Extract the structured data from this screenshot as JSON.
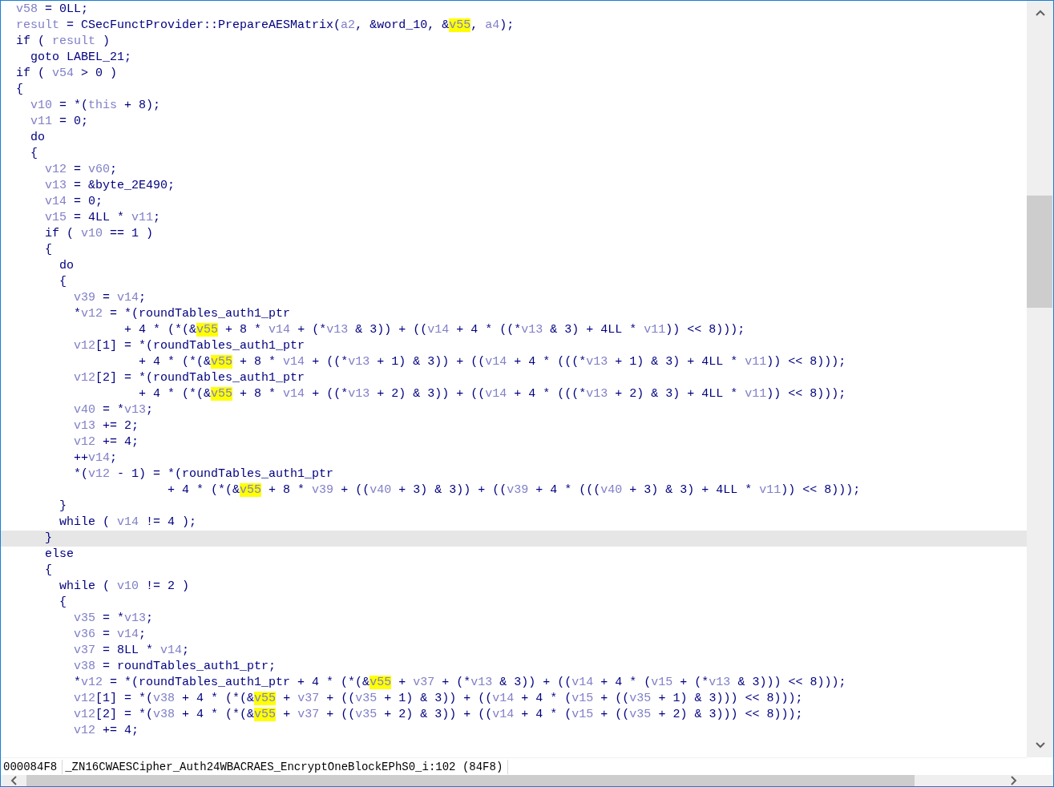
{
  "code_lines": [
    {
      "selected": false,
      "segments": [
        {
          "text": "  v58",
          "kind": "var"
        },
        {
          "text": " = 0LL;",
          "kind": "code"
        }
      ]
    },
    {
      "selected": false,
      "segments": [
        {
          "text": "  result",
          "kind": "var"
        },
        {
          "text": " = CSecFunctProvider::PrepareAESMatrix(",
          "kind": "code"
        },
        {
          "text": "a2",
          "kind": "var"
        },
        {
          "text": ", &word_10, &",
          "kind": "code"
        },
        {
          "text": "v55",
          "kind": "highlight"
        },
        {
          "text": ", ",
          "kind": "code"
        },
        {
          "text": "a4",
          "kind": "var"
        },
        {
          "text": ");",
          "kind": "code"
        }
      ]
    },
    {
      "selected": false,
      "segments": [
        {
          "text": "  if ( ",
          "kind": "code"
        },
        {
          "text": "result",
          "kind": "var"
        },
        {
          "text": " )",
          "kind": "code"
        }
      ]
    },
    {
      "selected": false,
      "segments": [
        {
          "text": "    goto LABEL_21;",
          "kind": "code"
        }
      ]
    },
    {
      "selected": false,
      "segments": [
        {
          "text": "  if ( ",
          "kind": "code"
        },
        {
          "text": "v54",
          "kind": "var"
        },
        {
          "text": " > 0 )",
          "kind": "code"
        }
      ]
    },
    {
      "selected": false,
      "segments": [
        {
          "text": "  {",
          "kind": "code"
        }
      ]
    },
    {
      "selected": false,
      "segments": [
        {
          "text": "    v10",
          "kind": "var"
        },
        {
          "text": " = *(",
          "kind": "code"
        },
        {
          "text": "this",
          "kind": "var"
        },
        {
          "text": " + 8);",
          "kind": "code"
        }
      ]
    },
    {
      "selected": false,
      "segments": [
        {
          "text": "    v11",
          "kind": "var"
        },
        {
          "text": " = 0;",
          "kind": "code"
        }
      ]
    },
    {
      "selected": false,
      "segments": [
        {
          "text": "    do",
          "kind": "code"
        }
      ]
    },
    {
      "selected": false,
      "segments": [
        {
          "text": "    {",
          "kind": "code"
        }
      ]
    },
    {
      "selected": false,
      "segments": [
        {
          "text": "      v12",
          "kind": "var"
        },
        {
          "text": " = ",
          "kind": "code"
        },
        {
          "text": "v60",
          "kind": "var"
        },
        {
          "text": ";",
          "kind": "code"
        }
      ]
    },
    {
      "selected": false,
      "segments": [
        {
          "text": "      v13",
          "kind": "var"
        },
        {
          "text": " = &byte_2E490;",
          "kind": "code"
        }
      ]
    },
    {
      "selected": false,
      "segments": [
        {
          "text": "      v14",
          "kind": "var"
        },
        {
          "text": " = 0;",
          "kind": "code"
        }
      ]
    },
    {
      "selected": false,
      "segments": [
        {
          "text": "      v15",
          "kind": "var"
        },
        {
          "text": " = 4LL * ",
          "kind": "code"
        },
        {
          "text": "v11",
          "kind": "var"
        },
        {
          "text": ";",
          "kind": "code"
        }
      ]
    },
    {
      "selected": false,
      "segments": [
        {
          "text": "      if ( ",
          "kind": "code"
        },
        {
          "text": "v10",
          "kind": "var"
        },
        {
          "text": " == 1 )",
          "kind": "code"
        }
      ]
    },
    {
      "selected": false,
      "segments": [
        {
          "text": "      {",
          "kind": "code"
        }
      ]
    },
    {
      "selected": false,
      "segments": [
        {
          "text": "        do",
          "kind": "code"
        }
      ]
    },
    {
      "selected": false,
      "segments": [
        {
          "text": "        {",
          "kind": "code"
        }
      ]
    },
    {
      "selected": false,
      "segments": [
        {
          "text": "          v39",
          "kind": "var"
        },
        {
          "text": " = ",
          "kind": "code"
        },
        {
          "text": "v14",
          "kind": "var"
        },
        {
          "text": ";",
          "kind": "code"
        }
      ]
    },
    {
      "selected": false,
      "segments": [
        {
          "text": "          *",
          "kind": "code"
        },
        {
          "text": "v12",
          "kind": "var"
        },
        {
          "text": " = *(roundTables_auth1_ptr",
          "kind": "code"
        }
      ]
    },
    {
      "selected": false,
      "segments": [
        {
          "text": "                 + 4 * (*(&",
          "kind": "code"
        },
        {
          "text": "v55",
          "kind": "highlight"
        },
        {
          "text": " + 8 * ",
          "kind": "code"
        },
        {
          "text": "v14",
          "kind": "var"
        },
        {
          "text": " + (*",
          "kind": "code"
        },
        {
          "text": "v13",
          "kind": "var"
        },
        {
          "text": " & 3)) + ((",
          "kind": "code"
        },
        {
          "text": "v14",
          "kind": "var"
        },
        {
          "text": " + 4 * ((*",
          "kind": "code"
        },
        {
          "text": "v13",
          "kind": "var"
        },
        {
          "text": " & 3) + 4LL * ",
          "kind": "code"
        },
        {
          "text": "v11",
          "kind": "var"
        },
        {
          "text": ")) << 8)));",
          "kind": "code"
        }
      ]
    },
    {
      "selected": false,
      "segments": [
        {
          "text": "          v12",
          "kind": "var"
        },
        {
          "text": "[1] = *(roundTables_auth1_ptr",
          "kind": "code"
        }
      ]
    },
    {
      "selected": false,
      "segments": [
        {
          "text": "                   + 4 * (*(&",
          "kind": "code"
        },
        {
          "text": "v55",
          "kind": "highlight"
        },
        {
          "text": " + 8 * ",
          "kind": "code"
        },
        {
          "text": "v14",
          "kind": "var"
        },
        {
          "text": " + ((*",
          "kind": "code"
        },
        {
          "text": "v13",
          "kind": "var"
        },
        {
          "text": " + 1) & 3)) + ((",
          "kind": "code"
        },
        {
          "text": "v14",
          "kind": "var"
        },
        {
          "text": " + 4 * (((*",
          "kind": "code"
        },
        {
          "text": "v13",
          "kind": "var"
        },
        {
          "text": " + 1) & 3) + 4LL * ",
          "kind": "code"
        },
        {
          "text": "v11",
          "kind": "var"
        },
        {
          "text": ")) << 8)));",
          "kind": "code"
        }
      ]
    },
    {
      "selected": false,
      "segments": [
        {
          "text": "          v12",
          "kind": "var"
        },
        {
          "text": "[2] = *(roundTables_auth1_ptr",
          "kind": "code"
        }
      ]
    },
    {
      "selected": false,
      "segments": [
        {
          "text": "                   + 4 * (*(&",
          "kind": "code"
        },
        {
          "text": "v55",
          "kind": "highlight"
        },
        {
          "text": " + 8 * ",
          "kind": "code"
        },
        {
          "text": "v14",
          "kind": "var"
        },
        {
          "text": " + ((*",
          "kind": "code"
        },
        {
          "text": "v13",
          "kind": "var"
        },
        {
          "text": " + 2) & 3)) + ((",
          "kind": "code"
        },
        {
          "text": "v14",
          "kind": "var"
        },
        {
          "text": " + 4 * (((*",
          "kind": "code"
        },
        {
          "text": "v13",
          "kind": "var"
        },
        {
          "text": " + 2) & 3) + 4LL * ",
          "kind": "code"
        },
        {
          "text": "v11",
          "kind": "var"
        },
        {
          "text": ")) << 8)));",
          "kind": "code"
        }
      ]
    },
    {
      "selected": false,
      "segments": [
        {
          "text": "          v40",
          "kind": "var"
        },
        {
          "text": " = *",
          "kind": "code"
        },
        {
          "text": "v13",
          "kind": "var"
        },
        {
          "text": ";",
          "kind": "code"
        }
      ]
    },
    {
      "selected": false,
      "segments": [
        {
          "text": "          v13",
          "kind": "var"
        },
        {
          "text": " += 2;",
          "kind": "code"
        }
      ]
    },
    {
      "selected": false,
      "segments": [
        {
          "text": "          v12",
          "kind": "var"
        },
        {
          "text": " += 4;",
          "kind": "code"
        }
      ]
    },
    {
      "selected": false,
      "segments": [
        {
          "text": "          ++",
          "kind": "code"
        },
        {
          "text": "v14",
          "kind": "var"
        },
        {
          "text": ";",
          "kind": "code"
        }
      ]
    },
    {
      "selected": false,
      "segments": [
        {
          "text": "          *(",
          "kind": "code"
        },
        {
          "text": "v12",
          "kind": "var"
        },
        {
          "text": " - 1) = *(roundTables_auth1_ptr",
          "kind": "code"
        }
      ]
    },
    {
      "selected": false,
      "segments": [
        {
          "text": "                       + 4 * (*(&",
          "kind": "code"
        },
        {
          "text": "v55",
          "kind": "highlight"
        },
        {
          "text": " + 8 * ",
          "kind": "code"
        },
        {
          "text": "v39",
          "kind": "var"
        },
        {
          "text": " + ((",
          "kind": "code"
        },
        {
          "text": "v40",
          "kind": "var"
        },
        {
          "text": " + 3) & 3)) + ((",
          "kind": "code"
        },
        {
          "text": "v39",
          "kind": "var"
        },
        {
          "text": " + 4 * (((",
          "kind": "code"
        },
        {
          "text": "v40",
          "kind": "var"
        },
        {
          "text": " + 3) & 3) + 4LL * ",
          "kind": "code"
        },
        {
          "text": "v11",
          "kind": "var"
        },
        {
          "text": ")) << 8)));",
          "kind": "code"
        }
      ]
    },
    {
      "selected": false,
      "segments": [
        {
          "text": "        }",
          "kind": "code"
        }
      ]
    },
    {
      "selected": false,
      "segments": [
        {
          "text": "        while ( ",
          "kind": "code"
        },
        {
          "text": "v14",
          "kind": "var"
        },
        {
          "text": " != 4 );",
          "kind": "code"
        }
      ]
    },
    {
      "selected": true,
      "segments": [
        {
          "text": "      }",
          "kind": "code"
        }
      ]
    },
    {
      "selected": false,
      "segments": [
        {
          "text": "      else",
          "kind": "code"
        }
      ]
    },
    {
      "selected": false,
      "segments": [
        {
          "text": "      {",
          "kind": "code"
        }
      ]
    },
    {
      "selected": false,
      "segments": [
        {
          "text": "        while ( ",
          "kind": "code"
        },
        {
          "text": "v10",
          "kind": "var"
        },
        {
          "text": " != 2 )",
          "kind": "code"
        }
      ]
    },
    {
      "selected": false,
      "segments": [
        {
          "text": "        {",
          "kind": "code"
        }
      ]
    },
    {
      "selected": false,
      "segments": [
        {
          "text": "          v35",
          "kind": "var"
        },
        {
          "text": " = *",
          "kind": "code"
        },
        {
          "text": "v13",
          "kind": "var"
        },
        {
          "text": ";",
          "kind": "code"
        }
      ]
    },
    {
      "selected": false,
      "segments": [
        {
          "text": "          v36",
          "kind": "var"
        },
        {
          "text": " = ",
          "kind": "code"
        },
        {
          "text": "v14",
          "kind": "var"
        },
        {
          "text": ";",
          "kind": "code"
        }
      ]
    },
    {
      "selected": false,
      "segments": [
        {
          "text": "          v37",
          "kind": "var"
        },
        {
          "text": " = 8LL * ",
          "kind": "code"
        },
        {
          "text": "v14",
          "kind": "var"
        },
        {
          "text": ";",
          "kind": "code"
        }
      ]
    },
    {
      "selected": false,
      "segments": [
        {
          "text": "          v38",
          "kind": "var"
        },
        {
          "text": " = roundTables_auth1_ptr;",
          "kind": "code"
        }
      ]
    },
    {
      "selected": false,
      "segments": [
        {
          "text": "          *",
          "kind": "code"
        },
        {
          "text": "v12",
          "kind": "var"
        },
        {
          "text": " = *(roundTables_auth1_ptr + 4 * (*(&",
          "kind": "code"
        },
        {
          "text": "v55",
          "kind": "highlight"
        },
        {
          "text": " + ",
          "kind": "code"
        },
        {
          "text": "v37",
          "kind": "var"
        },
        {
          "text": " + (*",
          "kind": "code"
        },
        {
          "text": "v13",
          "kind": "var"
        },
        {
          "text": " & 3)) + ((",
          "kind": "code"
        },
        {
          "text": "v14",
          "kind": "var"
        },
        {
          "text": " + 4 * (",
          "kind": "code"
        },
        {
          "text": "v15",
          "kind": "var"
        },
        {
          "text": " + (*",
          "kind": "code"
        },
        {
          "text": "v13",
          "kind": "var"
        },
        {
          "text": " & 3))) << 8)));",
          "kind": "code"
        }
      ]
    },
    {
      "selected": false,
      "segments": [
        {
          "text": "          v12",
          "kind": "var"
        },
        {
          "text": "[1] = *(",
          "kind": "code"
        },
        {
          "text": "v38",
          "kind": "var"
        },
        {
          "text": " + 4 * (*(&",
          "kind": "code"
        },
        {
          "text": "v55",
          "kind": "highlight"
        },
        {
          "text": " + ",
          "kind": "code"
        },
        {
          "text": "v37",
          "kind": "var"
        },
        {
          "text": " + ((",
          "kind": "code"
        },
        {
          "text": "v35",
          "kind": "var"
        },
        {
          "text": " + 1) & 3)) + ((",
          "kind": "code"
        },
        {
          "text": "v14",
          "kind": "var"
        },
        {
          "text": " + 4 * (",
          "kind": "code"
        },
        {
          "text": "v15",
          "kind": "var"
        },
        {
          "text": " + ((",
          "kind": "code"
        },
        {
          "text": "v35",
          "kind": "var"
        },
        {
          "text": " + 1) & 3))) << 8)));",
          "kind": "code"
        }
      ]
    },
    {
      "selected": false,
      "segments": [
        {
          "text": "          v12",
          "kind": "var"
        },
        {
          "text": "[2] = *(",
          "kind": "code"
        },
        {
          "text": "v38",
          "kind": "var"
        },
        {
          "text": " + 4 * (*(&",
          "kind": "code"
        },
        {
          "text": "v55",
          "kind": "highlight"
        },
        {
          "text": " + ",
          "kind": "code"
        },
        {
          "text": "v37",
          "kind": "var"
        },
        {
          "text": " + ((",
          "kind": "code"
        },
        {
          "text": "v35",
          "kind": "var"
        },
        {
          "text": " + 2) & 3)) + ((",
          "kind": "code"
        },
        {
          "text": "v14",
          "kind": "var"
        },
        {
          "text": " + 4 * (",
          "kind": "code"
        },
        {
          "text": "v15",
          "kind": "var"
        },
        {
          "text": " + ((",
          "kind": "code"
        },
        {
          "text": "v35",
          "kind": "var"
        },
        {
          "text": " + 2) & 3))) << 8)));",
          "kind": "code"
        }
      ]
    },
    {
      "selected": false,
      "segments": [
        {
          "text": "          v12",
          "kind": "var"
        },
        {
          "text": " += 4;",
          "kind": "code"
        }
      ]
    }
  ],
  "status_bar": {
    "address": "000084F8",
    "location": "_ZN16CWAESCipher_Auth24WBACRAES_EncryptOneBlockEPhS0_i:102 (84F8)"
  }
}
